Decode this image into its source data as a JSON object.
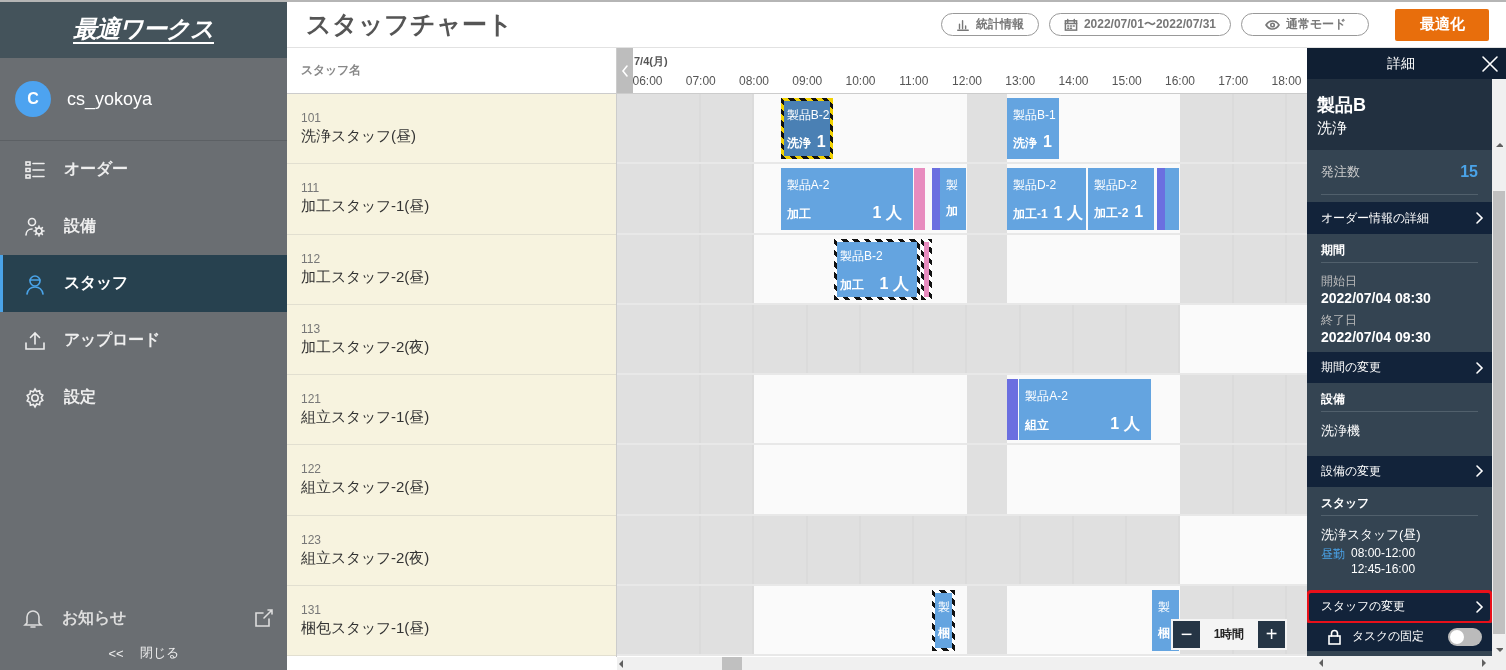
{
  "sidebar": {
    "logo": "最適ワークス",
    "user": {
      "initial": "C",
      "name": "cs_yokoya"
    },
    "items": [
      {
        "label": "オーダー",
        "selected": false
      },
      {
        "label": "設備",
        "selected": false
      },
      {
        "label": "スタッフ",
        "selected": true
      },
      {
        "label": "アップロード",
        "selected": false
      },
      {
        "label": "設定",
        "selected": false
      }
    ],
    "notice": "お知らせ",
    "collapse": {
      "arrow": "<<",
      "label": "閉じる"
    }
  },
  "header": {
    "title": "スタッフチャート",
    "buttons": [
      "統計情報",
      "2022/07/01〜2022/07/31",
      "通常モード"
    ],
    "primary": "最適化"
  },
  "chart": {
    "staff_heading": "スタッフ名",
    "date": "7/4(月)",
    "hours": [
      "06:00",
      "07:00",
      "08:00",
      "09:00",
      "10:00",
      "11:00",
      "12:00",
      "13:00",
      "14:00",
      "15:00",
      "16:00",
      "17:00",
      "18:00"
    ],
    "rows": [
      {
        "code": "101",
        "name": "洗浄スタッフ(昼)",
        "kind": "day",
        "tasks": [
          {
            "color": "#4a80b4",
            "selected": true,
            "linked": false,
            "name": "製品B-2",
            "label": "洗浄",
            "count": "1"
          },
          {
            "color": "#64a4e0",
            "selected": false,
            "linked": false,
            "name": "製品B-1",
            "label": "洗浄",
            "count": "1"
          }
        ]
      },
      {
        "code": "111",
        "name": "加工スタッフ-1(昼)",
        "kind": "day",
        "tasks": [
          {
            "color": "#64a4e0",
            "selected": false,
            "linked": false,
            "name": "製品A-2",
            "label": "加工",
            "count": "1 人"
          },
          {
            "color": "#e88cbf",
            "selected": false,
            "linked": false
          },
          {
            "color": "#6b6fe0",
            "selected": false,
            "linked": false
          },
          {
            "color": "#64a4e0",
            "selected": false,
            "linked": false,
            "name": "製",
            "label": "加"
          },
          {
            "color": "#64a4e0",
            "selected": false,
            "linked": false,
            "name": "製品D-2",
            "label": "加工-1",
            "count": "1 人"
          },
          {
            "color": "#64a4e0",
            "selected": false,
            "linked": false,
            "name": "製品D-2",
            "label": "加工-2",
            "count": "1"
          },
          {
            "color": "#6b6fe0",
            "selected": false,
            "linked": false
          },
          {
            "color": "#64a4e0",
            "selected": false,
            "linked": false
          }
        ]
      },
      {
        "code": "112",
        "name": "加工スタッフ-2(昼)",
        "kind": "day",
        "tasks": [
          {
            "color": "#64a4e0",
            "selected": false,
            "linked": true,
            "name": "製品B-2",
            "label": "加工",
            "count": "1 人"
          },
          {
            "color": "#e88cbf",
            "selected": false,
            "linked": true
          }
        ]
      },
      {
        "code": "113",
        "name": "加工スタッフ-2(夜)",
        "kind": "night"
      },
      {
        "code": "121",
        "name": "組立スタッフ-1(昼)",
        "kind": "day",
        "tasks": [
          {
            "color": "#6b6fe0",
            "selected": false,
            "linked": false
          },
          {
            "color": "#64a4e0",
            "selected": false,
            "linked": false,
            "name": "製品A-2",
            "label": "組立",
            "count": "1 人"
          }
        ]
      },
      {
        "code": "122",
        "name": "組立スタッフ-2(昼)",
        "kind": "day"
      },
      {
        "code": "123",
        "name": "組立スタッフ-2(夜)",
        "kind": "night"
      },
      {
        "code": "131",
        "name": "梱包スタッフ-1(昼)",
        "kind": "day",
        "tasks": [
          {
            "color": "#64a4e0",
            "selected": false,
            "linked": true,
            "name": "製",
            "label": "梱"
          },
          {
            "color": "#64a4e0",
            "selected": false,
            "linked": false,
            "name": "製",
            "label": "梱"
          }
        ]
      }
    ],
    "zoom": {
      "minus": "−",
      "label": "1時間",
      "plus": "+"
    }
  },
  "detail": {
    "title": "詳細",
    "product": "製品B",
    "process": "洗浄",
    "items": [
      {
        "kind": "stat",
        "label": "発注数",
        "value": "15"
      },
      {
        "kind": "link",
        "label": "オーダー情報の詳細",
        "highlighted": false
      },
      {
        "kind": "heading",
        "label": "期間"
      },
      {
        "kind": "field",
        "label": "開始日",
        "value": "2022/07/04 08:30"
      },
      {
        "kind": "field",
        "label": "終了日",
        "value": "2022/07/04 09:30"
      },
      {
        "kind": "link",
        "label": "期間の変更",
        "highlighted": false
      },
      {
        "kind": "heading",
        "label": "設備"
      },
      {
        "kind": "text",
        "label": "洗浄機"
      },
      {
        "kind": "link",
        "label": "設備の変更",
        "highlighted": false
      },
      {
        "kind": "heading",
        "label": "スタッフ"
      },
      {
        "kind": "text",
        "label": "洗浄スタッフ(昼)"
      },
      {
        "kind": "shift",
        "label": "昼勤",
        "times": [
          "08:00-12:00",
          "12:45-16:00"
        ]
      },
      {
        "kind": "link",
        "label": "スタッフの変更",
        "highlighted": true
      }
    ],
    "lock": {
      "label": "タスクの固定",
      "on": false
    }
  }
}
